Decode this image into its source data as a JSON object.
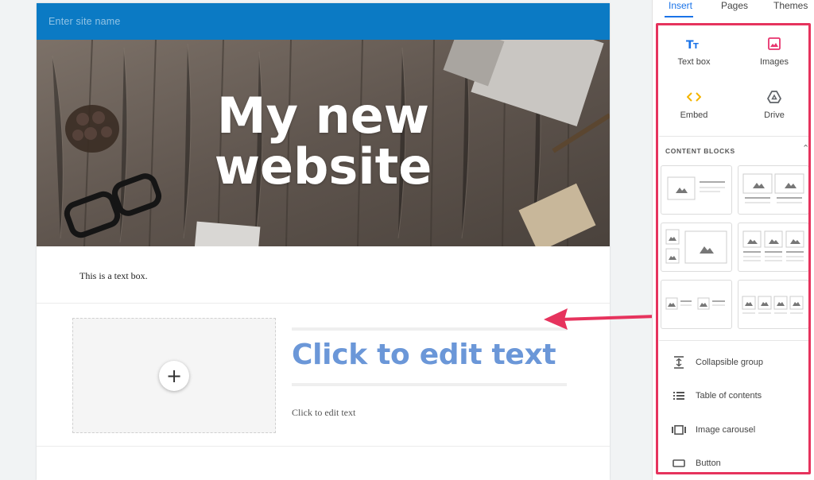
{
  "site": {
    "name_placeholder": "Enter site name",
    "hero_title_line1": "My new",
    "hero_title_line2": "website",
    "textbox": "This is  a text box.",
    "edit_title": "Click to edit text",
    "edit_body": "Click to edit text",
    "add_symbol": "+"
  },
  "panel": {
    "tabs": [
      {
        "label": "Insert",
        "active": true
      },
      {
        "label": "Pages",
        "active": false
      },
      {
        "label": "Themes",
        "active": false
      }
    ],
    "insert_items": [
      {
        "label": "Text box",
        "icon": "text-box-icon",
        "color": "#1a73e8"
      },
      {
        "label": "Images",
        "icon": "image-icon",
        "color": "#e8336d"
      },
      {
        "label": "Embed",
        "icon": "embed-icon",
        "color": "#f4b400"
      },
      {
        "label": "Drive",
        "icon": "drive-icon",
        "color": "#5f6368"
      }
    ],
    "content_blocks_label": "CONTENT BLOCKS",
    "list_items": [
      {
        "label": "Collapsible group",
        "icon": "collapsible-group-icon"
      },
      {
        "label": "Table of contents",
        "icon": "table-of-contents-icon"
      },
      {
        "label": "Image carousel",
        "icon": "image-carousel-icon"
      },
      {
        "label": "Button",
        "icon": "button-icon"
      }
    ]
  },
  "colors": {
    "site_bar": "#0b7ac4",
    "highlight": "#e6335d",
    "edit_title": "#6b97d8",
    "accent": "#1a73e8"
  }
}
